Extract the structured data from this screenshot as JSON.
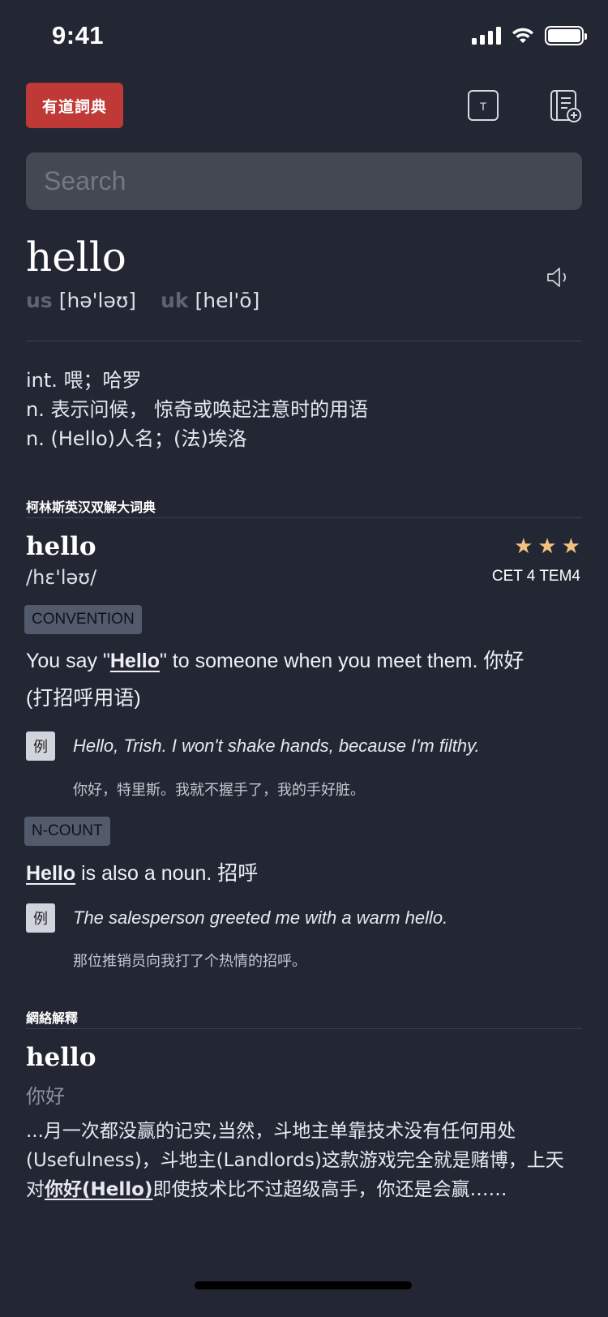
{
  "status": {
    "time": "9:41"
  },
  "header": {
    "logo": "有道詞典",
    "font_button": "T"
  },
  "search": {
    "placeholder": "Search",
    "value": ""
  },
  "word": {
    "title": "hello",
    "us_label": "us",
    "us_phonetic": "[hə'ləʊ]",
    "uk_label": "uk",
    "uk_phonetic": "[hel'ō]"
  },
  "basic_defs": [
    "int. 喂；哈罗",
    "n. 表示问候， 惊奇或唤起注意时的用语",
    "n. (Hello)人名；(法)埃洛"
  ],
  "collins": {
    "section_title": "柯林斯英汉双解大词典",
    "word": "hello",
    "phonetic": "/hɛ'ləʊ/",
    "stars": 3,
    "exam": "CET 4 TEM4",
    "senses": [
      {
        "tag": "CONVENTION",
        "def_before": "You say \"",
        "def_word": "Hello",
        "def_after": "\" to someone when you meet them. 你好",
        "def_line2": "(打招呼用语)",
        "example_badge": "例",
        "example_en": "Hello, Trish. I won't shake hands, because I'm filthy.",
        "example_zh": "你好，特里斯。我就不握手了，我的手好脏。"
      },
      {
        "tag": "N-COUNT",
        "def_word": "Hello",
        "def_after": " is also a noun. 招呼",
        "example_badge": "例",
        "example_en": "The salesperson greeted me with a warm hello.",
        "example_zh": "那位推销员向我打了个热情的招呼。"
      }
    ]
  },
  "web": {
    "section_title": "網絡解釋",
    "word": "hello",
    "translation": "你好",
    "text_before": "...月一次都没赢的记实,当然，斗地主单靠技术没有任何用处(Usefulness)，斗地主(Landlords)这款游戏完全就是赌博，上天对",
    "text_highlight": "你好(Hello)",
    "text_after": "即使技术比不过超级高手，你还是会赢……"
  }
}
